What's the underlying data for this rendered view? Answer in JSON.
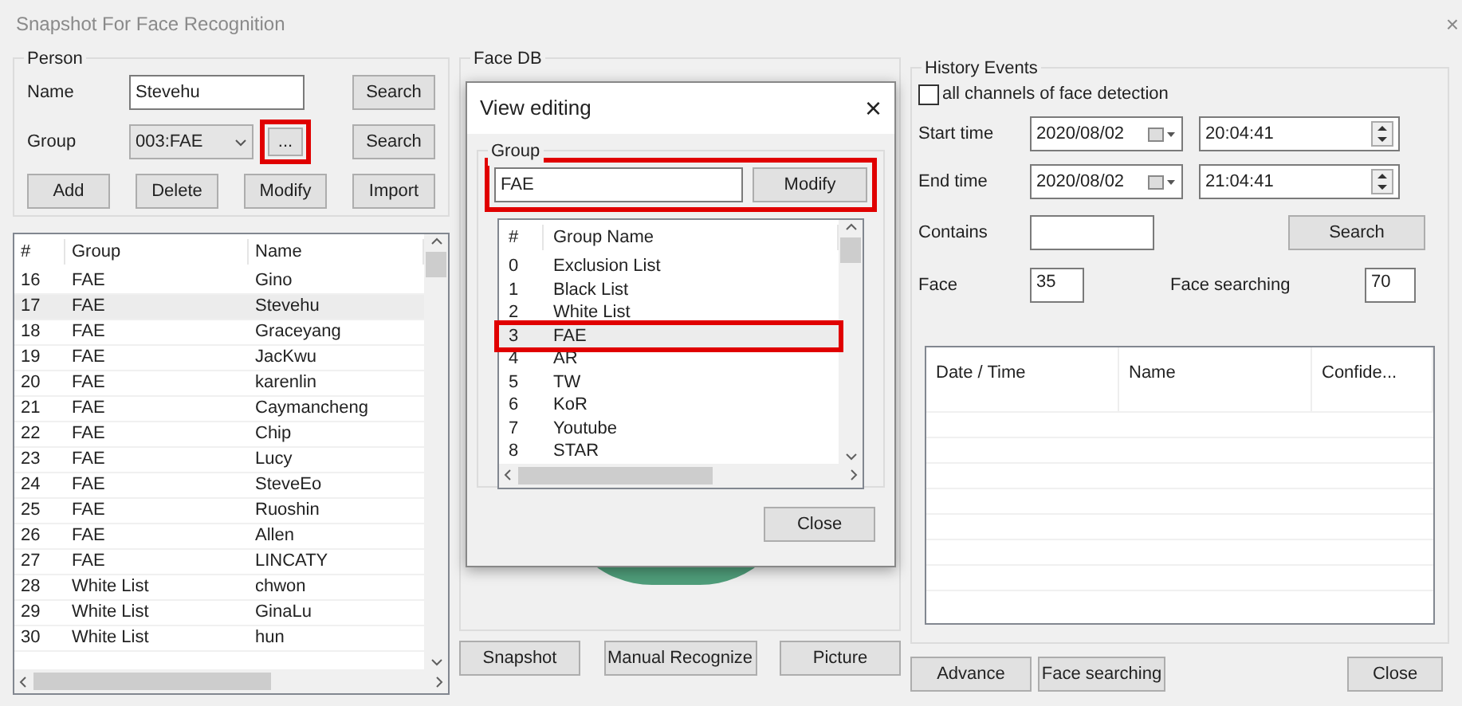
{
  "window": {
    "title": "Snapshot For Face Recognition",
    "close": "×"
  },
  "person": {
    "legend": "Person",
    "name_label": "Name",
    "name_value": "Stevehu",
    "name_search": "Search",
    "group_label": "Group",
    "group_value": "003:FAE",
    "group_more": {
      "label": "...",
      "highlighted": true
    },
    "group_search": "Search",
    "buttons": [
      "Add",
      "Delete",
      "Modify",
      "Import"
    ],
    "table": {
      "columns": [
        "#",
        "Group",
        "Name"
      ],
      "rows": [
        {
          "cells": [
            "16",
            "FAE",
            "Gino"
          ],
          "selected": false
        },
        {
          "cells": [
            "17",
            "FAE",
            "Stevehu"
          ],
          "selected": true
        },
        {
          "cells": [
            "18",
            "FAE",
            "Graceyang"
          ],
          "selected": false
        },
        {
          "cells": [
            "19",
            "FAE",
            "JacKwu"
          ],
          "selected": false
        },
        {
          "cells": [
            "20",
            "FAE",
            "karenlin"
          ],
          "selected": false
        },
        {
          "cells": [
            "21",
            "FAE",
            "Caymancheng"
          ],
          "selected": false
        },
        {
          "cells": [
            "22",
            "FAE",
            "Chip"
          ],
          "selected": false
        },
        {
          "cells": [
            "23",
            "FAE",
            "Lucy"
          ],
          "selected": false
        },
        {
          "cells": [
            "24",
            "FAE",
            "SteveEo"
          ],
          "selected": false
        },
        {
          "cells": [
            "25",
            "FAE",
            "Ruoshin"
          ],
          "selected": false
        },
        {
          "cells": [
            "26",
            "FAE",
            "Allen"
          ],
          "selected": false
        },
        {
          "cells": [
            "27",
            "FAE",
            "LINCATY"
          ],
          "selected": false
        },
        {
          "cells": [
            "28",
            "White List",
            "chwon"
          ],
          "selected": false
        },
        {
          "cells": [
            "29",
            "White List",
            "GinaLu"
          ],
          "selected": false
        },
        {
          "cells": [
            "30",
            "White List",
            "hun"
          ],
          "selected": false
        }
      ]
    }
  },
  "face_db": {
    "legend": "Face DB",
    "buttons": [
      "Snapshot",
      "Manual Recognize",
      "Picture"
    ]
  },
  "dialog": {
    "title": "View editing",
    "close": "×",
    "legend": "Group",
    "input_value": "FAE",
    "modify": "Modify",
    "editor_highlighted": true,
    "columns": [
      "#",
      "Group Name"
    ],
    "rows": [
      {
        "cells": [
          "0",
          "Exclusion List"
        ],
        "selected": false,
        "highlighted": false
      },
      {
        "cells": [
          "1",
          "Black List"
        ],
        "selected": false,
        "highlighted": false
      },
      {
        "cells": [
          "2",
          "White List"
        ],
        "selected": false,
        "highlighted": false
      },
      {
        "cells": [
          "3",
          "FAE"
        ],
        "selected": true,
        "highlighted": true
      },
      {
        "cells": [
          "4",
          "AR"
        ],
        "selected": false,
        "highlighted": false
      },
      {
        "cells": [
          "5",
          "TW"
        ],
        "selected": false,
        "highlighted": false
      },
      {
        "cells": [
          "6",
          "KoR"
        ],
        "selected": false,
        "highlighted": false
      },
      {
        "cells": [
          "7",
          "Youtube"
        ],
        "selected": false,
        "highlighted": false
      },
      {
        "cells": [
          "8",
          "STAR"
        ],
        "selected": false,
        "highlighted": false
      }
    ],
    "close_button": "Close"
  },
  "history": {
    "legend": "History Events",
    "all_channels": {
      "label": "all channels of face detection",
      "checked": false
    },
    "start_label": "Start time",
    "start_date": "2020/08/02",
    "start_time": "20:04:41",
    "end_label": "End time",
    "end_date": "2020/08/02",
    "end_time": "21:04:41",
    "contains_label": "Contains",
    "search": "Search",
    "face_label": "Face",
    "face_value": "35",
    "face_searching_label": "Face searching",
    "face_searching_value": "70",
    "columns": [
      "Date / Time",
      "Name",
      "Confide..."
    ]
  },
  "bottom_buttons": [
    "Advance",
    "Face searching"
  ],
  "close_button": "Close"
}
